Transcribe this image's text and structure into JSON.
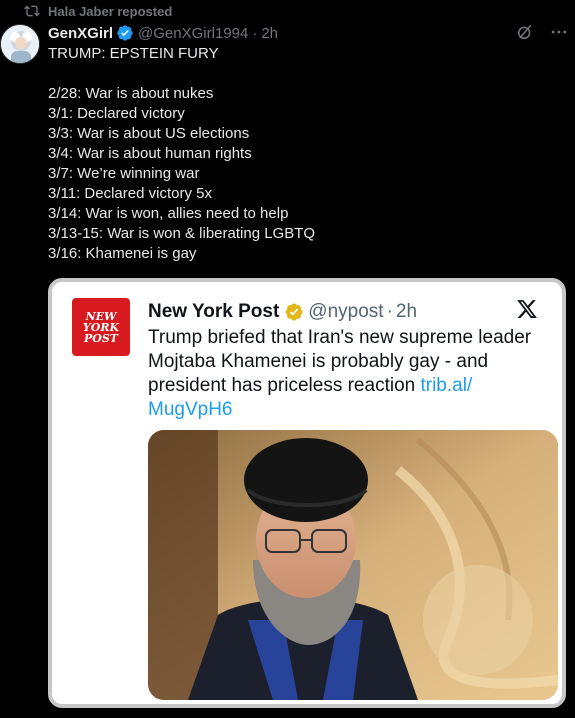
{
  "repost": {
    "text": "Hala Jaber reposted",
    "icon": "repost-icon"
  },
  "author": {
    "name": "GenXGirl",
    "handle": "@GenXGirl1994",
    "separator": "·",
    "time": "2h",
    "verified_color": "#1d9bf0"
  },
  "tweet_text": "TRUMP: EPSTEIN FURY\n\n2/28: War is about nukes\n3/1: Declared victory\n3/3: War is about US elections\n3/4: War is about human rights\n3/7: We’re winning war\n3/11: Declared victory 5x\n3/14: War is won, allies need to help\n3/13-15: War is won & liberating LGBTQ\n3/16: Khamenei is gay",
  "embed": {
    "logo_lines": [
      "NEW",
      "YORK",
      "POST"
    ],
    "name": "New York Post",
    "handle": "@nypost",
    "separator": "·",
    "time": "2h",
    "verified_color": "#e2b719",
    "text": "Trump briefed that Iran's new supreme leader Mojtaba Khamenei is probably gay - and president has priceless reaction ",
    "link": "trib.al/\nMugVpH6"
  },
  "colors": {
    "background": "#000000",
    "link": "#1d9bf0",
    "brand_red": "#d71920"
  }
}
